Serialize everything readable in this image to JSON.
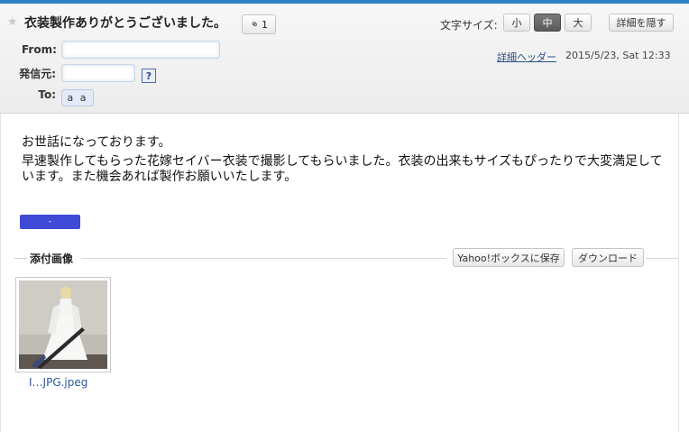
{
  "header": {
    "subject": "衣装製作ありがとうございました。",
    "attachment_count": "1",
    "font_size_label": "文字サイズ:",
    "font_sizes": [
      "小",
      "中",
      "大"
    ],
    "font_size_selected": "中",
    "hide_details_label": "詳細を隠す",
    "from_label": "From:",
    "sender_label": "発信元:",
    "help_label": "?",
    "to_label": "To:",
    "to_value": "a a",
    "detail_header_link": "詳細ヘッダー",
    "date": "2015/5/23, Sat 12:33"
  },
  "body": {
    "line1": "お世話になっております。",
    "line2": "早速製作してもらった花嫁セイバー衣装で撮影してもらいました。衣装の出来もサイズもぴったりで大変満足しています。また機会あれば製作お願いいたします。",
    "signature": "-"
  },
  "attachments": {
    "title": "添付画像",
    "save_button": "Yahoo!ボックスに保存",
    "download_button": "ダウンロード",
    "file_name": "I…JPG.jpeg"
  },
  "icons": {
    "star": "star-icon",
    "clip": "paperclip-icon"
  },
  "colors": {
    "accent": "#2e7fc6",
    "link": "#2a4d86",
    "signature_bar": "#3f4bd6"
  }
}
